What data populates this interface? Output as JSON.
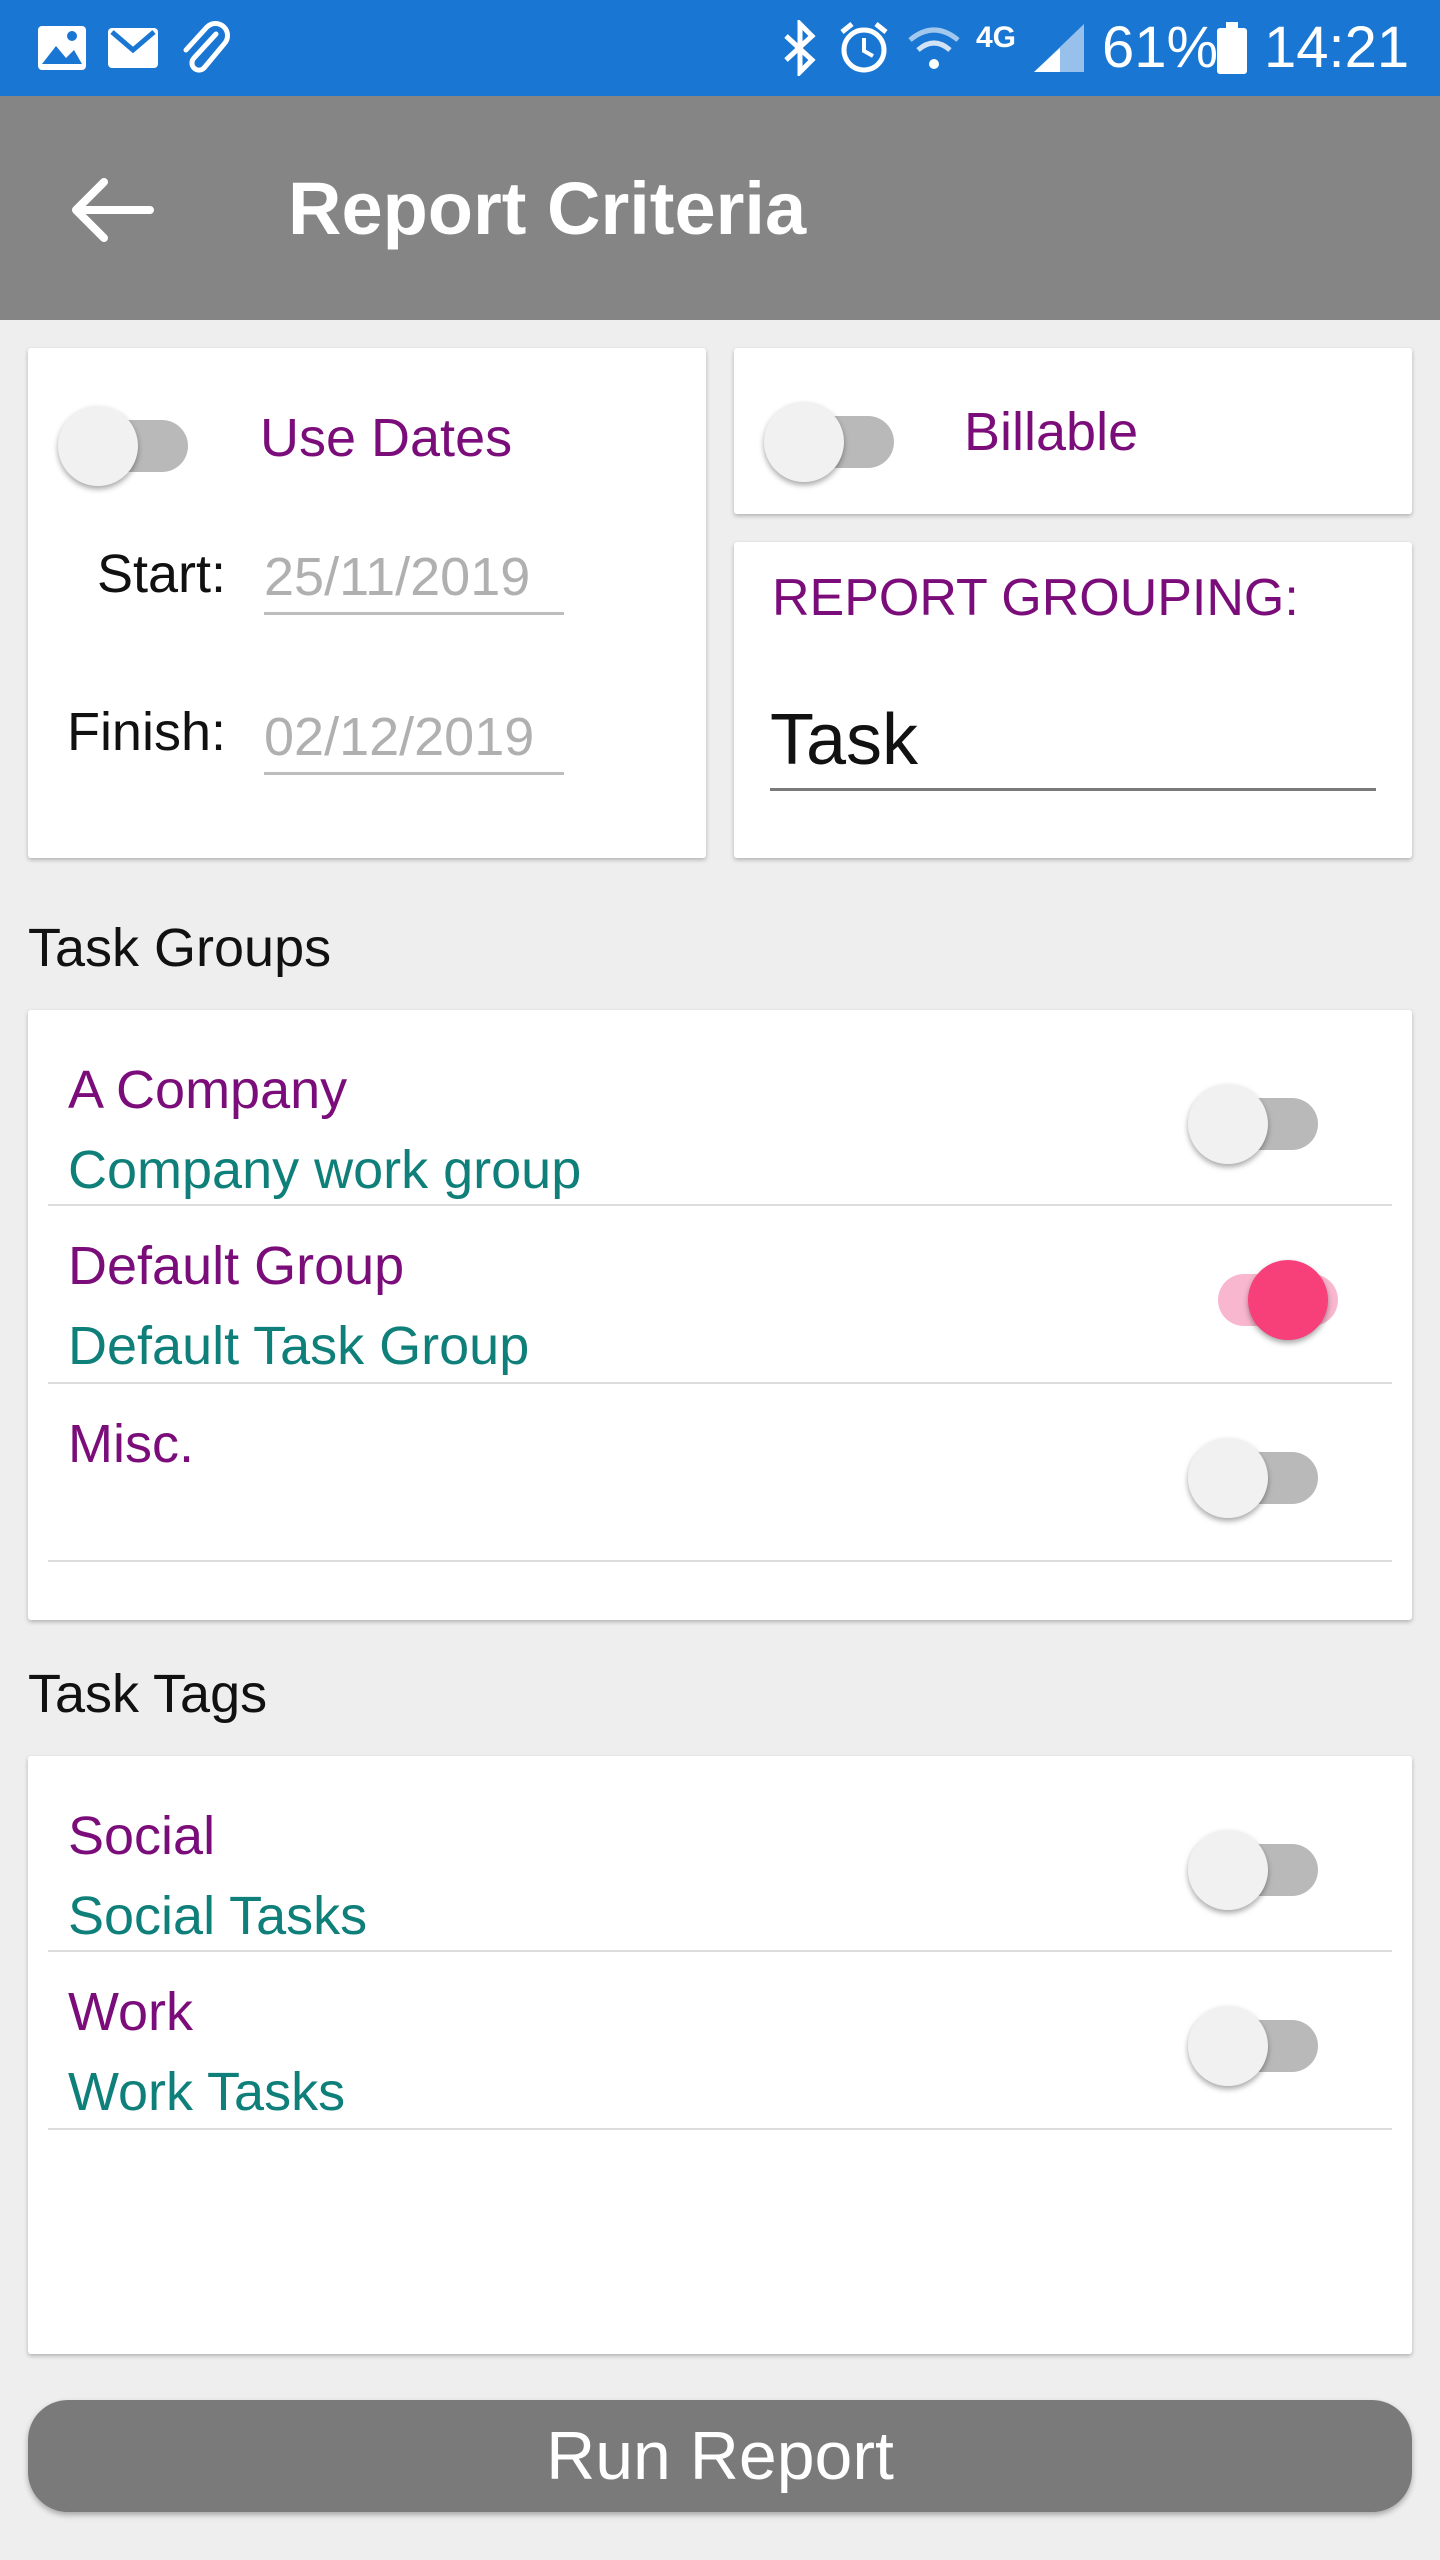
{
  "status_bar": {
    "battery_percent": "61%",
    "time": "14:21",
    "network": "4G",
    "left_icons": [
      "image-icon",
      "gmail-icon",
      "paperclip-icon"
    ],
    "right_icons": [
      "bluetooth-icon",
      "alarm-icon",
      "wifi-icon",
      "signal-icon",
      "battery-icon"
    ],
    "color": "#1976d2"
  },
  "appbar": {
    "title": "Report Criteria",
    "color": "#858585"
  },
  "dates_card": {
    "use_dates_label": "Use Dates",
    "use_dates_on": false,
    "start_label": "Start:",
    "start_placeholder": "25/11/2019",
    "finish_label": "Finish:",
    "finish_placeholder": "02/12/2019"
  },
  "billable_card": {
    "label": "Billable",
    "on": false
  },
  "grouping_card": {
    "label": "REPORT GROUPING:",
    "value": "Task"
  },
  "task_groups": {
    "title": "Task Groups",
    "items": [
      {
        "name": "A Company",
        "description": "Company work group",
        "on": false
      },
      {
        "name": "Default Group",
        "description": "Default Task Group",
        "on": true
      },
      {
        "name": "Misc.",
        "description": "",
        "on": false
      }
    ]
  },
  "task_tags": {
    "title": "Task Tags",
    "items": [
      {
        "name": "Social",
        "description": "Social Tasks",
        "on": false
      },
      {
        "name": "Work",
        "description": "Work Tasks",
        "on": false
      }
    ]
  },
  "run_button": {
    "label": "Run Report"
  },
  "colors": {
    "name_text": "#7b0d7b",
    "description_text": "#0f7f7a",
    "switch_on": "#f73f7a"
  }
}
